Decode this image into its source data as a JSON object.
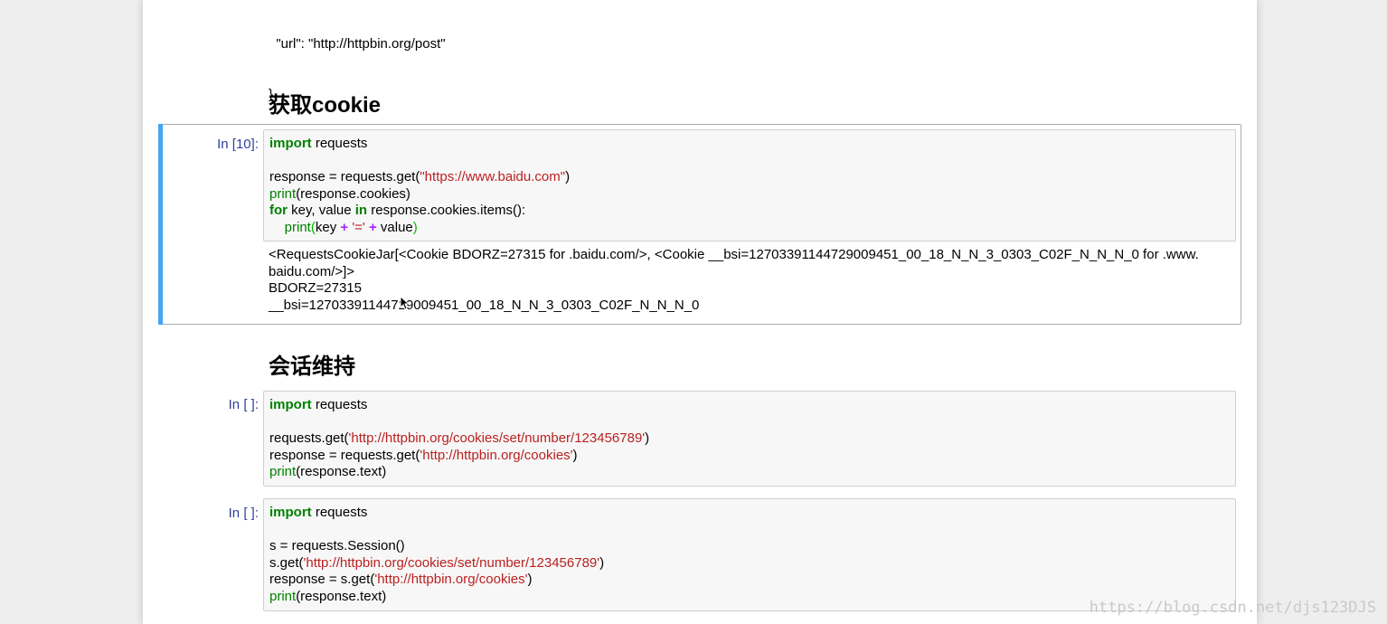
{
  "prev_output": {
    "lines": [
      "  \"url\": \"http://httpbin.org/post\"",
      "}"
    ]
  },
  "headings": {
    "get_cookie": "获取cookie",
    "session": "会话维持"
  },
  "cell10": {
    "prompt": "In [10]:",
    "code": [
      [
        {
          "t": "import",
          "c": "kw"
        },
        {
          "t": " requests"
        }
      ],
      [
        {
          "t": ""
        }
      ],
      [
        {
          "t": "response = requests.get("
        },
        {
          "t": "\"https://www.baidu.com\"",
          "c": "str"
        },
        {
          "t": ")"
        }
      ],
      [
        {
          "t": "print",
          "c": "bi"
        },
        {
          "t": "(response.cookies)"
        }
      ],
      [
        {
          "t": "for",
          "c": "kw"
        },
        {
          "t": " key, value "
        },
        {
          "t": "in",
          "c": "kw"
        },
        {
          "t": " response.cookies.items():"
        }
      ],
      [
        {
          "t": "    "
        },
        {
          "t": "print",
          "c": "bi"
        },
        {
          "t": "(",
          "c": "brk"
        },
        {
          "t": "key "
        },
        {
          "t": "+",
          "c": "op"
        },
        {
          "t": " "
        },
        {
          "t": "'='",
          "c": "str"
        },
        {
          "t": " "
        },
        {
          "t": "+",
          "c": "op"
        },
        {
          "t": " value"
        },
        {
          "t": ")",
          "c": "brk"
        }
      ]
    ],
    "output": [
      "<RequestsCookieJar[<Cookie BDORZ=27315 for .baidu.com/>, <Cookie __bsi=12703391144729009451_00_18_N_N_3_0303_C02F_N_N_N_0 for .www.",
      "baidu.com/>]>",
      "BDORZ=27315",
      "__bsi=12703391144729009451_00_18_N_N_3_0303_C02F_N_N_N_0"
    ]
  },
  "cell_a": {
    "prompt": "In [ ]:",
    "code": [
      [
        {
          "t": "import",
          "c": "kw"
        },
        {
          "t": " requests"
        }
      ],
      [
        {
          "t": ""
        }
      ],
      [
        {
          "t": "requests.get("
        },
        {
          "t": "'http://httpbin.org/cookies/set/number/123456789'",
          "c": "str"
        },
        {
          "t": ")"
        }
      ],
      [
        {
          "t": "response = requests.get("
        },
        {
          "t": "'http://httpbin.org/cookies'",
          "c": "str"
        },
        {
          "t": ")"
        }
      ],
      [
        {
          "t": "print",
          "c": "bi"
        },
        {
          "t": "(response.text)"
        }
      ]
    ]
  },
  "cell_b": {
    "prompt": "In [ ]:",
    "code": [
      [
        {
          "t": "import",
          "c": "kw"
        },
        {
          "t": " requests"
        }
      ],
      [
        {
          "t": ""
        }
      ],
      [
        {
          "t": "s = requests.Session()"
        }
      ],
      [
        {
          "t": "s.get("
        },
        {
          "t": "'http://httpbin.org/cookies/set/number/123456789'",
          "c": "str"
        },
        {
          "t": ")"
        }
      ],
      [
        {
          "t": "response = s.get("
        },
        {
          "t": "'http://httpbin.org/cookies'",
          "c": "str"
        },
        {
          "t": ")"
        }
      ],
      [
        {
          "t": "print",
          "c": "bi"
        },
        {
          "t": "(response.text)"
        }
      ]
    ]
  },
  "watermark": "https://blog.csdn.net/djs123DJS",
  "colors": {
    "keyword": "#008000",
    "string": "#ba2121",
    "operator": "#aa22ff",
    "prompt": "#303f9f",
    "selected_bar": "#42a5f5"
  }
}
